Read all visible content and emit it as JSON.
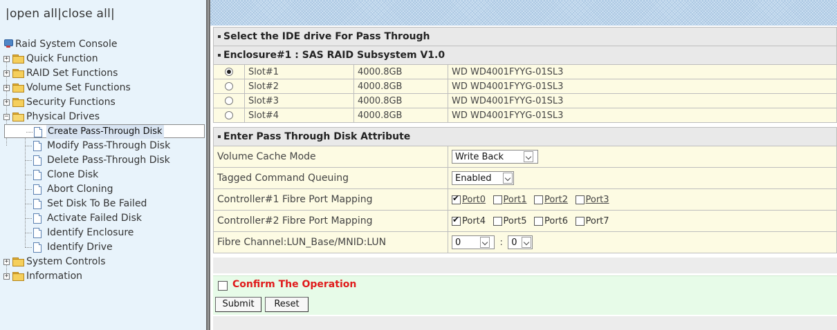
{
  "left": {
    "open_all": "open all",
    "close_all": "close all",
    "sep_left": "|",
    "sep_mid": "|",
    "sep_right": "|",
    "tree": {
      "root": "Raid System Console",
      "folders": [
        {
          "label": "Quick Function",
          "icon": "folder-icon",
          "expander": "+"
        },
        {
          "label": "RAID Set Functions",
          "icon": "folder-icon",
          "expander": "+"
        },
        {
          "label": "Volume Set Functions",
          "icon": "folder-icon",
          "expander": "+"
        },
        {
          "label": "Security Functions",
          "icon": "folder-icon",
          "expander": "+"
        },
        {
          "label": "Physical Drives",
          "icon": "folder-open-icon",
          "expander": "−"
        }
      ],
      "physical_drives_items": [
        {
          "label": "Create Pass-Through Disk",
          "selected": true
        },
        {
          "label": "Modify Pass-Through Disk"
        },
        {
          "label": "Delete Pass-Through Disk"
        },
        {
          "label": "Clone Disk"
        },
        {
          "label": "Abort Cloning"
        },
        {
          "label": "Set Disk To Be Failed"
        },
        {
          "label": "Activate Failed Disk"
        },
        {
          "label": "Identify Enclosure"
        },
        {
          "label": "Identify Drive"
        }
      ],
      "bottom_folders": [
        {
          "label": "System Controls",
          "expander": "+"
        },
        {
          "label": "Information",
          "expander": "+"
        }
      ]
    }
  },
  "main": {
    "section1_title": "Select the IDE drive For Pass Through",
    "enclosure_title": "Enclosure#1 : SAS RAID Subsystem V1.0",
    "drives": [
      {
        "slot": "Slot#1",
        "capacity": "4000.8GB",
        "model": "WD WD4001FYYG-01SL3",
        "selected": true
      },
      {
        "slot": "Slot#2",
        "capacity": "4000.8GB",
        "model": "WD WD4001FYYG-01SL3",
        "selected": false
      },
      {
        "slot": "Slot#3",
        "capacity": "4000.8GB",
        "model": "WD WD4001FYYG-01SL3",
        "selected": false
      },
      {
        "slot": "Slot#4",
        "capacity": "4000.8GB",
        "model": "WD WD4001FYYG-01SL3",
        "selected": false
      }
    ],
    "section2_title": "Enter Pass Through Disk Attribute",
    "attributes": {
      "cache_mode_label": "Volume Cache Mode",
      "cache_mode_value": "Write Back",
      "tcq_label": "Tagged Command Queuing",
      "tcq_value": "Enabled",
      "ctrl1_label": "Controller#1 Fibre Port Mapping",
      "ctrl1_ports": [
        {
          "label": "Port0",
          "checked": true
        },
        {
          "label": "Port1",
          "checked": false
        },
        {
          "label": "Port2",
          "checked": false
        },
        {
          "label": "Port3",
          "checked": false
        }
      ],
      "ctrl2_label": "Controller#2 Fibre Port Mapping",
      "ctrl2_ports": [
        {
          "label": "Port4",
          "checked": true
        },
        {
          "label": "Port5",
          "checked": false
        },
        {
          "label": "Port6",
          "checked": false
        },
        {
          "label": "Port7",
          "checked": false
        }
      ],
      "lun_label": "Fibre Channel:LUN_Base/MNID:LUN",
      "lun_base_value": "0",
      "lun_separator": ":",
      "lun_value": "0"
    },
    "confirm_label": "Confirm The Operation",
    "submit_label": "Submit",
    "reset_label": "Reset",
    "colors": {
      "confirm_text": "#e01b1b",
      "row_bg": "#fdfbe3",
      "confirm_bg": "#e7fbe8",
      "left_bg": "#e8f3fb"
    }
  }
}
